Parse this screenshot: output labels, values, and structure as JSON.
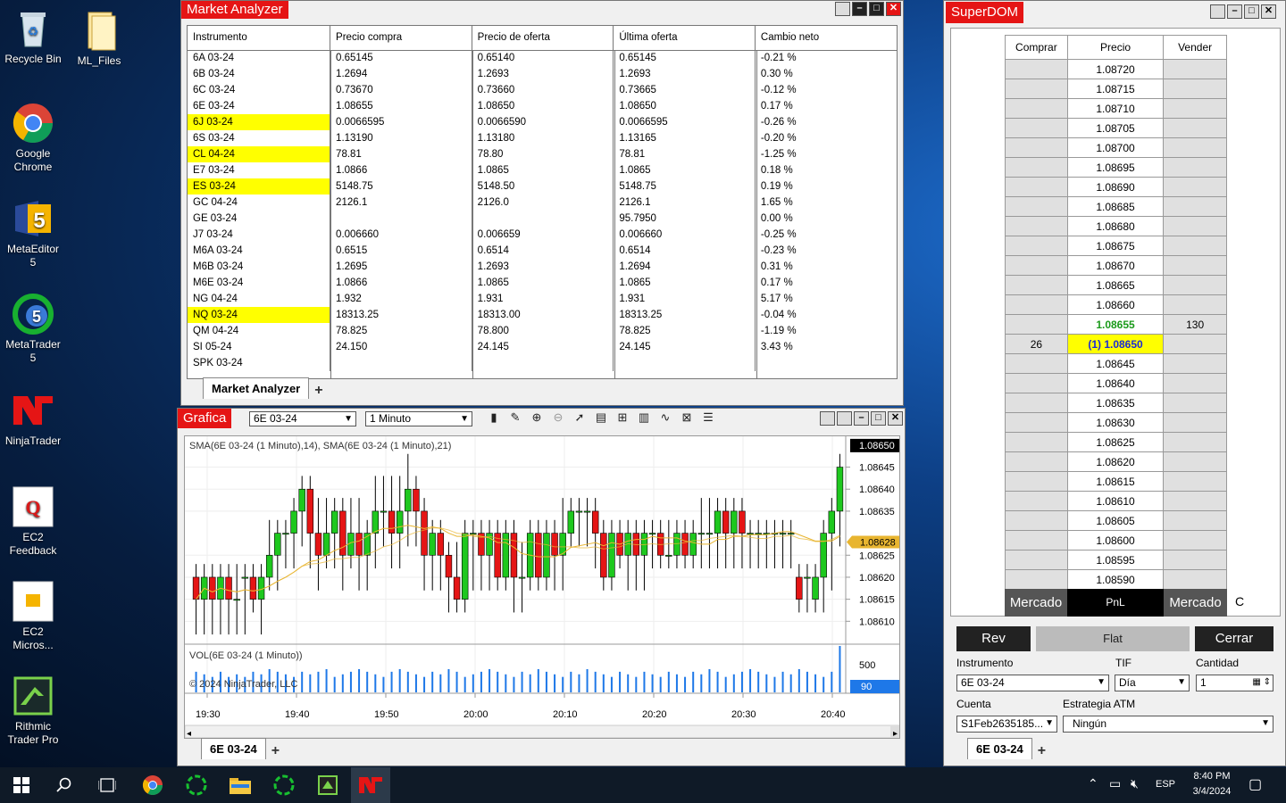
{
  "desktop": {
    "icons": [
      {
        "label": "Recycle Bin",
        "icon": "recycle-bin-icon"
      },
      {
        "label": "ML_Files",
        "icon": "folder-icon"
      },
      {
        "label": "Google Chrome",
        "icon": "chrome-icon"
      },
      {
        "label": "MetaEditor 5",
        "icon": "metaeditor-icon"
      },
      {
        "label": "MetaTrader 5",
        "icon": "metatrader-icon"
      },
      {
        "label": "NinjaTrader",
        "icon": "ninjatrader-icon"
      },
      {
        "label": "EC2 Feedback",
        "icon": "ec2-feedback-icon"
      },
      {
        "label": "EC2 Micros...",
        "icon": "ec2-icon"
      },
      {
        "label": "Rithmic Trader Pro",
        "icon": "rithmic-icon"
      }
    ]
  },
  "market_analyzer": {
    "title": "Market Analyzer",
    "columns": [
      "Instrumento",
      "Precio compra",
      "Precio de oferta",
      "Última oferta",
      "Cambio neto"
    ],
    "rows": [
      [
        "6A 03-24",
        "0.65145",
        "0.65140",
        "0.65145",
        "-0.21 %"
      ],
      [
        "6B 03-24",
        "1.2694",
        "1.2693",
        "1.2693",
        "0.30 %"
      ],
      [
        "6C 03-24",
        "0.73670",
        "0.73660",
        "0.73665",
        "-0.12 %"
      ],
      [
        "6E 03-24",
        "1.08655",
        "1.08650",
        "1.08650",
        "0.17 %"
      ],
      [
        "6J 03-24",
        "0.0066595",
        "0.0066590",
        "0.0066595",
        "-0.26 %"
      ],
      [
        "6S 03-24",
        "1.13190",
        "1.13180",
        "1.13165",
        "-0.20 %"
      ],
      [
        "CL 04-24",
        "78.81",
        "78.80",
        "78.81",
        "-1.25 %"
      ],
      [
        "E7 03-24",
        "1.0866",
        "1.0865",
        "1.0865",
        "0.18 %"
      ],
      [
        "ES 03-24",
        "5148.75",
        "5148.50",
        "5148.75",
        "0.19 %"
      ],
      [
        "GC 04-24",
        "2126.1",
        "2126.0",
        "2126.1",
        "1.65 %"
      ],
      [
        "GE 03-24",
        "",
        "",
        "95.7950",
        "0.00 %"
      ],
      [
        "J7 03-24",
        "0.006660",
        "0.006659",
        "0.006660",
        "-0.25 %"
      ],
      [
        "M6A 03-24",
        "0.6515",
        "0.6514",
        "0.6514",
        "-0.23 %"
      ],
      [
        "M6B 03-24",
        "1.2695",
        "1.2693",
        "1.2694",
        "0.31 %"
      ],
      [
        "M6E 03-24",
        "1.0866",
        "1.0865",
        "1.0865",
        "0.17 %"
      ],
      [
        "NG 04-24",
        "1.932",
        "1.931",
        "1.931",
        "5.17 %"
      ],
      [
        "NQ 03-24",
        "18313.25",
        "18313.00",
        "18313.25",
        "-0.04 %"
      ],
      [
        "QM 04-24",
        "78.825",
        "78.800",
        "78.825",
        "-1.19 %"
      ],
      [
        "SI 05-24",
        "24.150",
        "24.145",
        "24.145",
        "3.43 %"
      ],
      [
        "SPK 03-24",
        "",
        "",
        "",
        ""
      ]
    ],
    "highlighted": [
      "6J 03-24",
      "CL 04-24",
      "ES 03-24",
      "NQ 03-24"
    ],
    "tab": "Market Analyzer"
  },
  "chart": {
    "title": "Grafica",
    "instrument": "6E 03-24",
    "interval": "1 Minuto",
    "indicator_label": "SMA(6E 03-24 (1 Minuto),14), SMA(6E 03-24 (1 Minuto),21)",
    "volume_label": "VOL(6E 03-24 (1 Minuto))",
    "copyright": "© 2024 NinjaTrader, LLC",
    "price_ticks": [
      "1.08645",
      "1.08640",
      "1.08635",
      "1.08625",
      "1.08620",
      "1.08615",
      "1.08610"
    ],
    "last_price": "1.08650",
    "sma_price": "1.08628",
    "vol_tick": "500",
    "vol_last": "90",
    "time_ticks": [
      "19:30",
      "19:40",
      "19:50",
      "20:00",
      "20:10",
      "20:20",
      "20:30",
      "20:40"
    ],
    "tab": "6E 03-24",
    "colors": {
      "up": "#1ec81e",
      "down": "#e51515",
      "sma": "#e8b530",
      "vol": "#1e78e8"
    }
  },
  "chart_data": {
    "type": "candlestick",
    "ylim": [
      1.08605,
      1.08652
    ],
    "candles": [
      [
        1.0862,
        1.08615,
        1.0861,
        1.0862
      ],
      [
        1.08615,
        1.0862,
        1.0861,
        1.0862
      ],
      [
        1.0862,
        1.08615,
        1.0861,
        1.0862
      ],
      [
        1.08615,
        1.0862,
        1.0861,
        1.0862
      ],
      [
        1.0862,
        1.08615,
        1.0861,
        1.0862
      ],
      [
        1.08615,
        1.08615,
        1.0861,
        1.0862
      ],
      [
        1.0862,
        1.0862,
        1.0861,
        1.0862
      ],
      [
        1.0862,
        1.08615,
        1.08615,
        1.0862
      ],
      [
        1.08615,
        1.0862,
        1.0861,
        1.0862
      ],
      [
        1.0862,
        1.08625,
        1.0862,
        1.0863
      ],
      [
        1.08625,
        1.0863,
        1.0862,
        1.0863
      ],
      [
        1.0863,
        1.0863,
        1.08625,
        1.0863
      ],
      [
        1.0863,
        1.08635,
        1.08625,
        1.08635
      ],
      [
        1.08635,
        1.0864,
        1.0863,
        1.0864
      ],
      [
        1.0864,
        1.0863,
        1.08625,
        1.0864
      ],
      [
        1.0863,
        1.08625,
        1.0862,
        1.08635
      ],
      [
        1.08625,
        1.0863,
        1.08625,
        1.08635
      ],
      [
        1.0863,
        1.08635,
        1.08625,
        1.08635
      ],
      [
        1.08635,
        1.08625,
        1.0862,
        1.08635
      ],
      [
        1.08625,
        1.0863,
        1.08625,
        1.08635
      ],
      [
        1.0863,
        1.08625,
        1.0862,
        1.08635
      ],
      [
        1.08625,
        1.0863,
        1.0862,
        1.0863
      ],
      [
        1.0863,
        1.08635,
        1.08625,
        1.0864
      ],
      [
        1.08635,
        1.08635,
        1.0863,
        1.0864
      ],
      [
        1.08635,
        1.0863,
        1.08625,
        1.0864
      ],
      [
        1.0863,
        1.08635,
        1.08625,
        1.0864
      ],
      [
        1.08635,
        1.0864,
        1.0863,
        1.08645
      ],
      [
        1.0864,
        1.08635,
        1.0863,
        1.0864
      ],
      [
        1.08635,
        1.08625,
        1.0862,
        1.08635
      ],
      [
        1.08625,
        1.0863,
        1.0862,
        1.0863
      ],
      [
        1.0863,
        1.08625,
        1.0862,
        1.0863
      ],
      [
        1.08625,
        1.0862,
        1.08615,
        1.08625
      ],
      [
        1.0862,
        1.08615,
        1.08615,
        1.08625
      ],
      [
        1.08615,
        1.0863,
        1.08615,
        1.0863
      ],
      [
        1.0863,
        1.0863,
        1.0862,
        1.0863
      ],
      [
        1.0863,
        1.08625,
        1.0862,
        1.0863
      ],
      [
        1.08625,
        1.0863,
        1.0862,
        1.0863
      ],
      [
        1.0863,
        1.0862,
        1.0862,
        1.0863
      ],
      [
        1.0862,
        1.0863,
        1.0862,
        1.0863
      ],
      [
        1.0863,
        1.0862,
        1.08615,
        1.0863
      ],
      [
        1.0862,
        1.0862,
        1.08615,
        1.08625
      ],
      [
        1.0862,
        1.0863,
        1.0862,
        1.0863
      ],
      [
        1.0863,
        1.0862,
        1.0862,
        1.0863
      ],
      [
        1.0862,
        1.0863,
        1.0862,
        1.0863
      ],
      [
        1.0863,
        1.08625,
        1.0862,
        1.0863
      ],
      [
        1.08625,
        1.0863,
        1.0862,
        1.08635
      ],
      [
        1.0863,
        1.08635,
        1.0863,
        1.08635
      ],
      [
        1.08635,
        1.08635,
        1.0863,
        1.08635
      ],
      [
        1.08635,
        1.08635,
        1.0863,
        1.08635
      ],
      [
        1.08635,
        1.0863,
        1.08625,
        1.08635
      ],
      [
        1.0863,
        1.0862,
        1.0862,
        1.0863
      ],
      [
        1.0862,
        1.0863,
        1.0862,
        1.0863
      ],
      [
        1.0863,
        1.08625,
        1.08625,
        1.0863
      ],
      [
        1.08625,
        1.0863,
        1.0862,
        1.0863
      ],
      [
        1.0863,
        1.08625,
        1.0862,
        1.0863
      ],
      [
        1.08625,
        1.0863,
        1.0862,
        1.0863
      ],
      [
        1.0863,
        1.0863,
        1.08625,
        1.0863
      ],
      [
        1.0863,
        1.08625,
        1.08625,
        1.0863
      ],
      [
        1.08625,
        1.08625,
        1.08625,
        1.0863
      ],
      [
        1.08625,
        1.0863,
        1.08625,
        1.0863
      ],
      [
        1.0863,
        1.08625,
        1.08625,
        1.0863
      ],
      [
        1.08625,
        1.0863,
        1.08625,
        1.0863
      ],
      [
        1.0863,
        1.0863,
        1.08625,
        1.08635
      ],
      [
        1.0863,
        1.0863,
        1.08625,
        1.08635
      ],
      [
        1.0863,
        1.08635,
        1.08625,
        1.08635
      ],
      [
        1.08635,
        1.0863,
        1.08625,
        1.08635
      ],
      [
        1.0863,
        1.08635,
        1.08625,
        1.08635
      ],
      [
        1.08635,
        1.0863,
        1.08625,
        1.08635
      ],
      [
        1.0863,
        1.0863,
        1.08625,
        1.0863
      ],
      [
        1.0863,
        1.0863,
        1.08625,
        1.0863
      ],
      [
        1.0863,
        1.0863,
        1.08625,
        1.0863
      ],
      [
        1.0863,
        1.0863,
        1.08625,
        1.0863
      ],
      [
        1.0863,
        1.0863,
        1.08625,
        1.0863
      ],
      [
        1.0863,
        1.0863,
        1.08625,
        1.0863
      ],
      [
        1.0862,
        1.08615,
        1.08615,
        1.0862
      ],
      [
        1.0862,
        1.0862,
        1.08615,
        1.0862
      ],
      [
        1.08615,
        1.0862,
        1.08615,
        1.0862
      ],
      [
        1.0862,
        1.0863,
        1.08615,
        1.0863
      ],
      [
        1.0863,
        1.08635,
        1.0862,
        1.08635
      ],
      [
        1.08635,
        1.08645,
        1.0863,
        1.08645
      ]
    ],
    "volume": [
      40,
      35,
      30,
      40,
      30,
      35,
      30,
      40,
      35,
      45,
      40,
      35,
      30,
      40,
      35,
      40,
      45,
      30,
      35,
      40,
      45,
      40,
      35,
      30,
      40,
      45,
      40,
      35,
      30,
      40,
      35,
      45,
      40,
      30,
      35,
      40,
      45,
      40,
      35,
      30,
      40,
      35,
      45,
      40,
      35,
      30,
      40,
      35,
      45,
      40,
      35,
      30,
      40,
      35,
      30,
      40,
      35,
      30,
      40,
      35,
      30,
      40,
      35,
      45,
      40,
      30,
      35,
      40,
      45,
      40,
      35,
      30,
      40,
      35,
      45,
      40,
      35,
      30,
      40,
      90
    ]
  },
  "superdom": {
    "title": "SuperDOM",
    "col_buy": "Comprar",
    "col_price": "Precio",
    "col_sell": "Vender",
    "prices": [
      "1.08720",
      "1.08715",
      "1.08710",
      "1.08705",
      "1.08700",
      "1.08695",
      "1.08690",
      "1.08685",
      "1.08680",
      "1.08675",
      "1.08670",
      "1.08665",
      "1.08660",
      "1.08655",
      "(1) 1.08650",
      "1.08645",
      "1.08640",
      "1.08635",
      "1.08630",
      "1.08625",
      "1.08620",
      "1.08615",
      "1.08610",
      "1.08605",
      "1.08600",
      "1.08595",
      "1.08590"
    ],
    "sell_qty": "130",
    "buy_qty": "26",
    "ask_price_row": 13,
    "bid_price_row": 14,
    "market_buy": "Mercado",
    "pnl": "PnL",
    "market_sell": "Mercado",
    "extra": "C",
    "rev": "Rev",
    "flat": "Flat",
    "close": "Cerrar",
    "lbl_instrument": "Instrumento",
    "lbl_tif": "TIF",
    "lbl_qty": "Cantidad",
    "instrument": "6E 03-24",
    "tif": "Día",
    "qty": "1",
    "lbl_account": "Cuenta",
    "lbl_atm": "Estrategia ATM",
    "account": "S1Feb2635185...",
    "atm": "Ningún",
    "tab": "6E 03-24"
  },
  "taskbar": {
    "lang": "ESP",
    "time": "8:40 PM",
    "date": "3/4/2024"
  }
}
